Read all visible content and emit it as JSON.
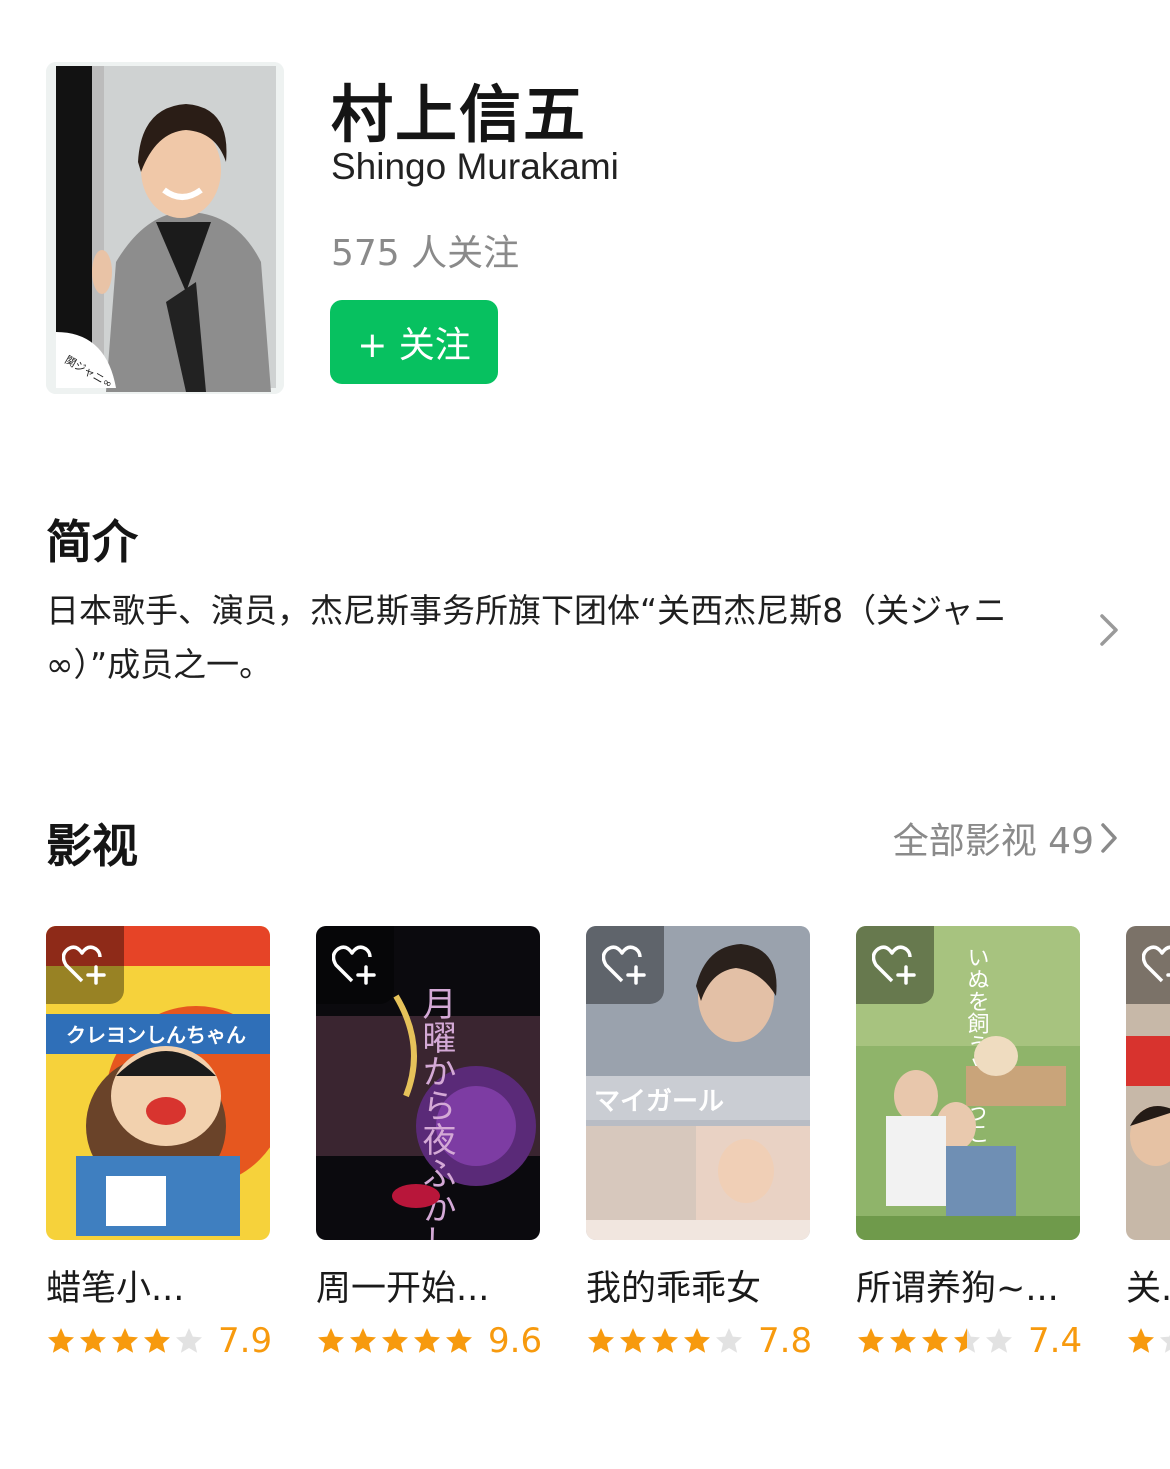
{
  "person": {
    "name": "村上信五",
    "name_en": "Shingo Murakami",
    "followers": "575 人关注",
    "follow_button": "+ 关注",
    "portrait_badge": "関ジャニ∞"
  },
  "intro": {
    "title": "简介",
    "text": "日本歌手、演员，杰尼斯事务所旗下团体“关西杰尼斯8（关ジャニ∞）”成员之一。"
  },
  "works": {
    "title": "影视",
    "see_all": "全部影视 49",
    "items": [
      {
        "title": "蜡笔小...",
        "score": "7.9",
        "rating": 4.0,
        "poster_text": "クレヨンしんちゃん"
      },
      {
        "title": "周一开始...",
        "score": "9.6",
        "rating": 5.0,
        "poster_text": "月曜から夜ふかし"
      },
      {
        "title": "我的乖乖女",
        "score": "7.8",
        "rating": 4.0,
        "poster_text": "マイガール"
      },
      {
        "title": "所谓养狗~...",
        "score": "7.4",
        "rating": 3.5,
        "poster_text": "いぬを飼うということ"
      },
      {
        "title": "关...",
        "score": "",
        "rating": 1.0,
        "poster_text": ""
      }
    ]
  },
  "colors": {
    "accent_green": "#07c160",
    "star_orange": "#f79a0e",
    "star_empty": "#e2e2e2",
    "muted_text": "#8a8a8a"
  },
  "icons": [
    "wishlist-heart-plus-icon",
    "chevron-right-icon",
    "star-icon"
  ]
}
